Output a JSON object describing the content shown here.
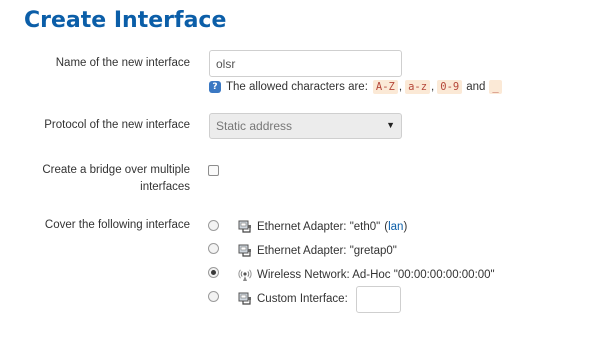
{
  "page": {
    "title": "Create Interface"
  },
  "form": {
    "name": {
      "label": "Name of the new interface",
      "value": "olsr",
      "hint_prefix": "The allowed characters are:",
      "allowed": [
        "A-Z",
        "a-z",
        "0-9",
        "_"
      ],
      "comma": ",",
      "and_text": "and"
    },
    "protocol": {
      "label": "Protocol of the new interface",
      "selected": "Static address"
    },
    "bridge": {
      "label_line1": "Create a bridge over multiple",
      "label_line2": "interfaces",
      "checked": false
    },
    "cover": {
      "label": "Cover the following interface",
      "options": [
        {
          "text": "Ethernet Adapter: \"eth0\"",
          "link_open": "(",
          "link": "lan",
          "link_close": ")",
          "icon": "ethernet-icon",
          "checked": false
        },
        {
          "text": "Ethernet Adapter: \"gretap0\"",
          "icon": "ethernet-icon",
          "checked": false
        },
        {
          "text": "Wireless Network: Ad-Hoc \"00:00:00:00:00:00\"",
          "icon": "wireless-icon",
          "checked": true
        },
        {
          "text": "Custom Interface:",
          "icon": "ethernet-icon",
          "checked": false,
          "value": ""
        }
      ]
    }
  },
  "colors": {
    "title": "#0b5ea8",
    "link": "#0b5ea8",
    "code_bg": "#fbe9d6",
    "code_fg": "#b5473a"
  }
}
